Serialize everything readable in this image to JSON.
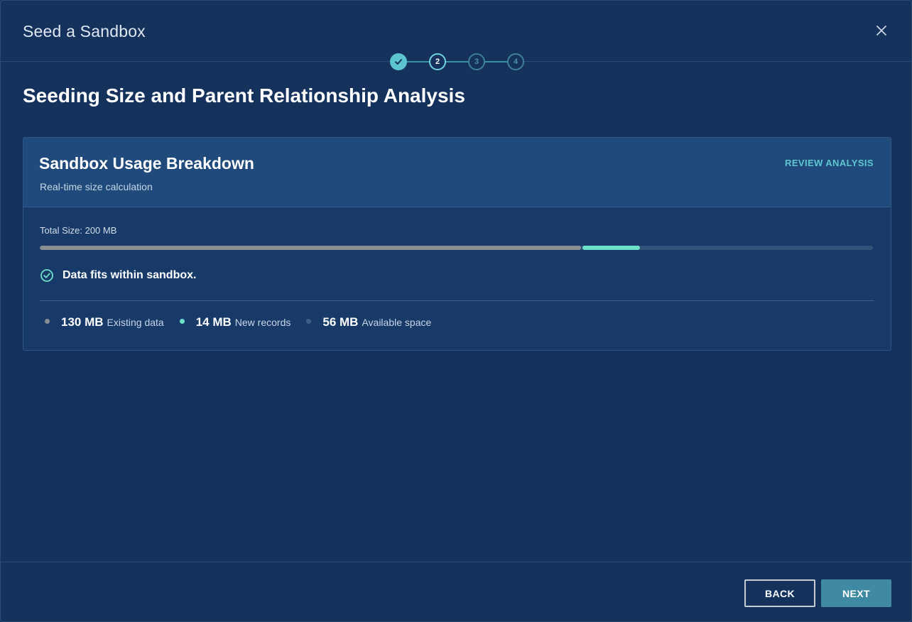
{
  "modal": {
    "title": "Seed a Sandbox"
  },
  "stepper": {
    "steps": [
      {
        "label": "",
        "state": "done"
      },
      {
        "label": "2",
        "state": "active"
      },
      {
        "label": "3",
        "state": "todo"
      },
      {
        "label": "4",
        "state": "todo"
      }
    ]
  },
  "page": {
    "title": "Seeding Size and Parent Relationship Analysis"
  },
  "card": {
    "title": "Sandbox Usage Breakdown",
    "subtitle": "Real-time size calculation",
    "review_link": "REVIEW ANALYSIS",
    "total_size": "Total Size: 200 MB",
    "status": "Data fits within sandbox.",
    "usage": {
      "total_mb": 200,
      "existing_mb": 130,
      "new_mb": 14,
      "available_mb": 56
    },
    "legend": [
      {
        "value": "130 MB",
        "label": "Existing data",
        "color": "#8a8f93"
      },
      {
        "value": "14 MB",
        "label": "New records",
        "color": "#6fe0c8"
      },
      {
        "value": "56 MB",
        "label": "Available space",
        "color": "#3b5f88"
      }
    ]
  },
  "footer": {
    "back_label": "BACK",
    "next_label": "NEXT"
  },
  "colors": {
    "background": "#15325d",
    "accent": "#5ec7cf",
    "primary_button": "#3f8aa2",
    "success": "#6fe0c8"
  }
}
